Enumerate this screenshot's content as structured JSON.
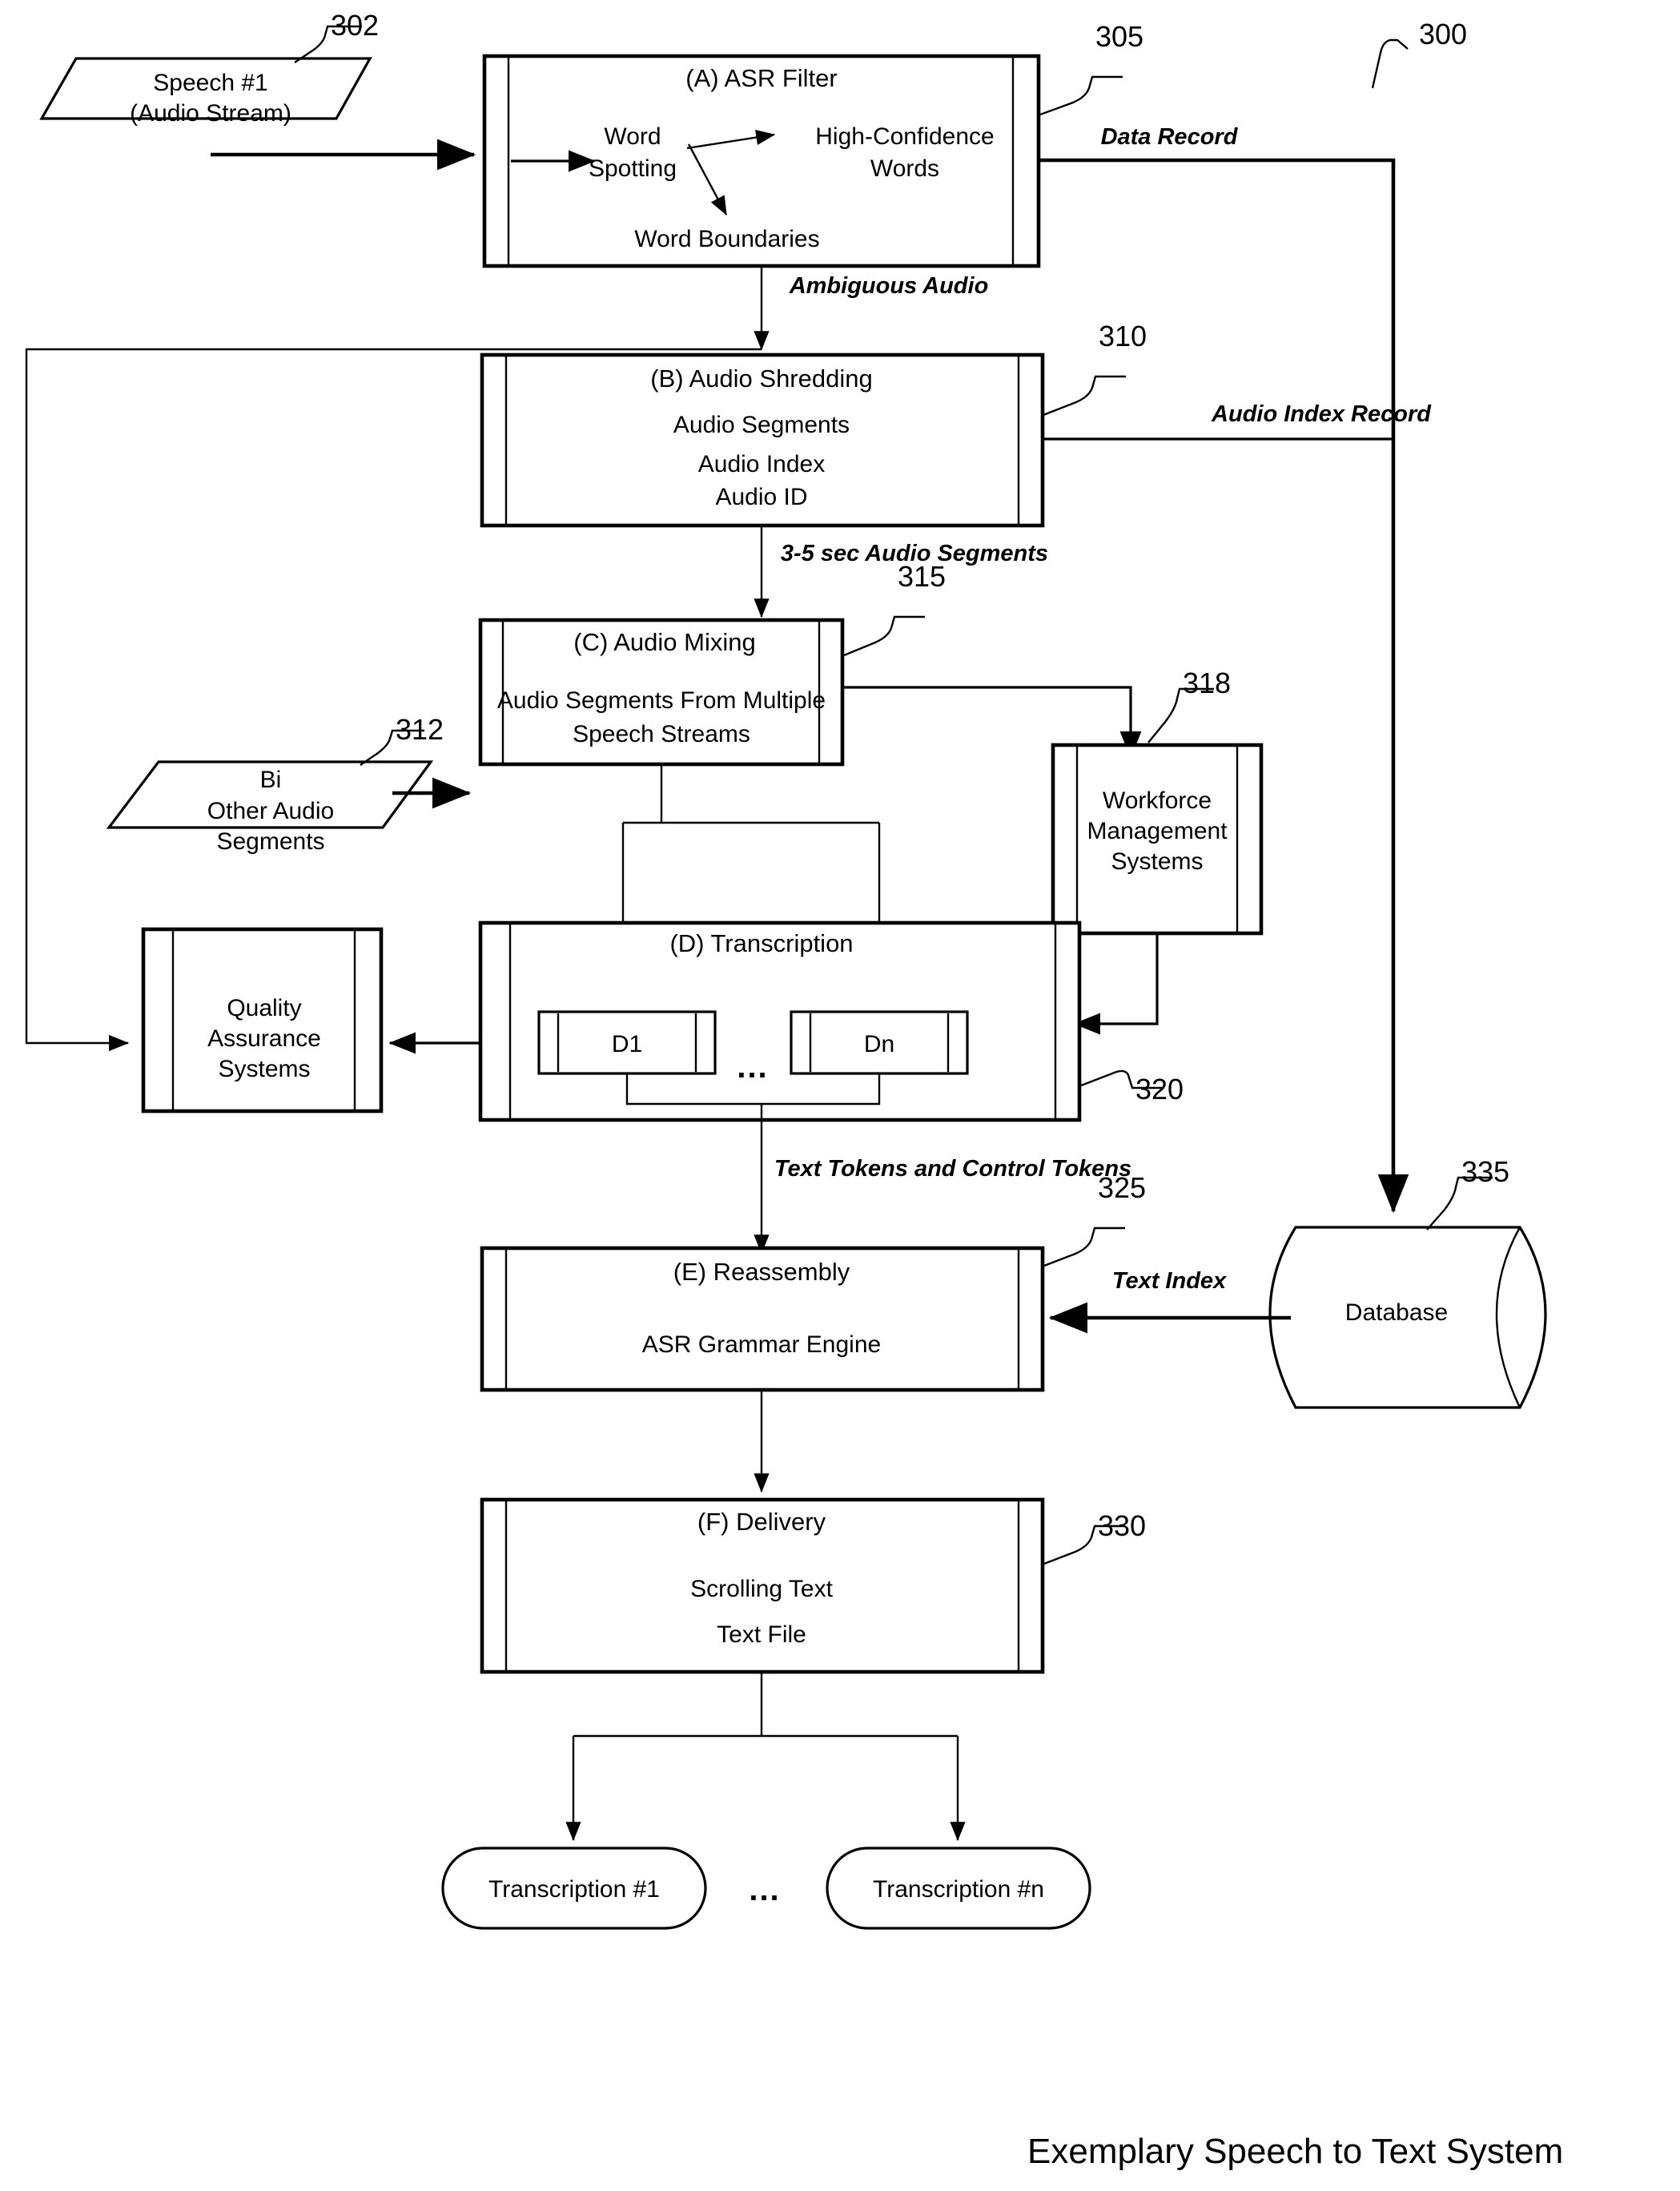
{
  "figure": {
    "caption": "Exemplary Speech to Text System",
    "system_ref": "300"
  },
  "nodes": {
    "speech_input": {
      "ref": "302",
      "line1": "Speech #1",
      "line2": "(Audio Stream)",
      "shape": "parallelogram"
    },
    "asr_filter": {
      "ref": "305",
      "title": "(A) ASR Filter",
      "word_spotting_l1": "Word",
      "word_spotting_l2": "Spotting",
      "high_confidence_l1": "High-Confidence",
      "high_confidence_l2": "Words",
      "word_boundaries": "Word Boundaries"
    },
    "audio_shredding": {
      "ref": "310",
      "title": "(B) Audio Shredding",
      "line1": "Audio Segments",
      "line2": "Audio Index",
      "line3": "Audio ID"
    },
    "other_audio": {
      "ref": "312",
      "line1": "Bi",
      "line2": "Other Audio",
      "line3": "Segments",
      "shape": "parallelogram"
    },
    "audio_mixing": {
      "ref": "315",
      "title": "(C) Audio Mixing",
      "line1": "Audio Segments From Multiple",
      "line2": "Speech Streams"
    },
    "workforce": {
      "ref": "318",
      "line1": "Workforce",
      "line2": "Management",
      "line3": "Systems"
    },
    "transcription": {
      "ref": "320",
      "title": "(D) Transcription",
      "d1": "D1",
      "dn": "Dn",
      "ellipsis": "..."
    },
    "quality_assurance": {
      "line1": "Quality",
      "line2": "Assurance",
      "line3": "Systems"
    },
    "reassembly": {
      "ref": "325",
      "title": "(E) Reassembly",
      "line1": "ASR Grammar Engine"
    },
    "database": {
      "ref": "335",
      "label": "Database",
      "shape": "cylinder"
    },
    "delivery": {
      "ref": "330",
      "title": "(F) Delivery",
      "line1": "Scrolling Text",
      "line2": "Text File"
    },
    "transcription_out_1": {
      "label": "Transcription #1",
      "shape": "stadium"
    },
    "transcription_out_n": {
      "label": "Transcription #n",
      "shape": "stadium"
    },
    "transcription_out_ellipsis": {
      "label": "..."
    }
  },
  "edges": {
    "data_record": "Data Record",
    "ambiguous_audio": "Ambiguous Audio",
    "audio_index_record": "Audio Index Record",
    "segments_3_5": "3-5 sec Audio Segments",
    "text_and_control_tokens": "Text Tokens and Control Tokens",
    "text_index": "Text Index"
  },
  "colors": {
    "stroke": "#000000",
    "background": "#ffffff"
  }
}
